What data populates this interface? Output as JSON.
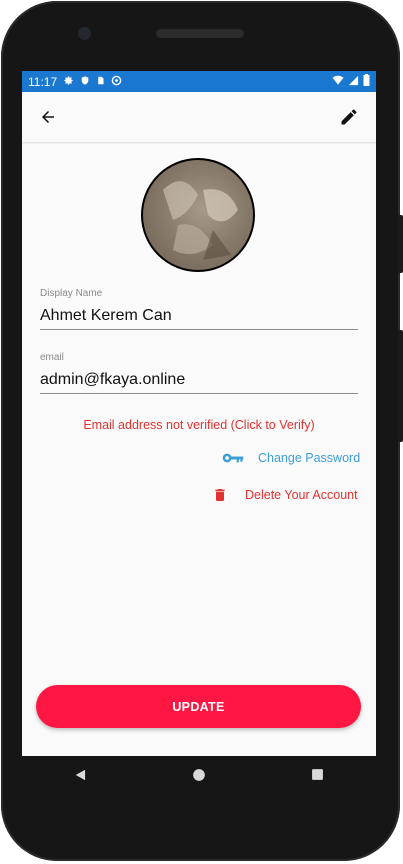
{
  "status_bar": {
    "time": "11:17",
    "icons": [
      "gear-icon",
      "shield-icon",
      "sim-card-icon",
      "sync-icon",
      "wifi-icon",
      "signal-icon",
      "battery-icon"
    ]
  },
  "app_bar": {
    "back_icon": "arrow-left-icon",
    "edit_icon": "pencil-icon"
  },
  "profile": {
    "display_name_label": "Display Name",
    "display_name_value": "Ahmet Kerem Can",
    "email_label": "email",
    "email_value": "admin@fkaya.online",
    "verify_notice": "Email address not verified (Click to Verify)"
  },
  "actions": {
    "change_password": "Change Password",
    "delete_account": "Delete Your Account",
    "update": "UPDATE"
  },
  "colors": {
    "status_bar": "#1b78d0",
    "accent_blue": "#3d9ed8",
    "danger_red": "#e0322f",
    "update_button": "#ff1744"
  },
  "nav_bar": {
    "icons": [
      "back-triangle-icon",
      "home-circle-icon",
      "recents-square-icon"
    ]
  }
}
